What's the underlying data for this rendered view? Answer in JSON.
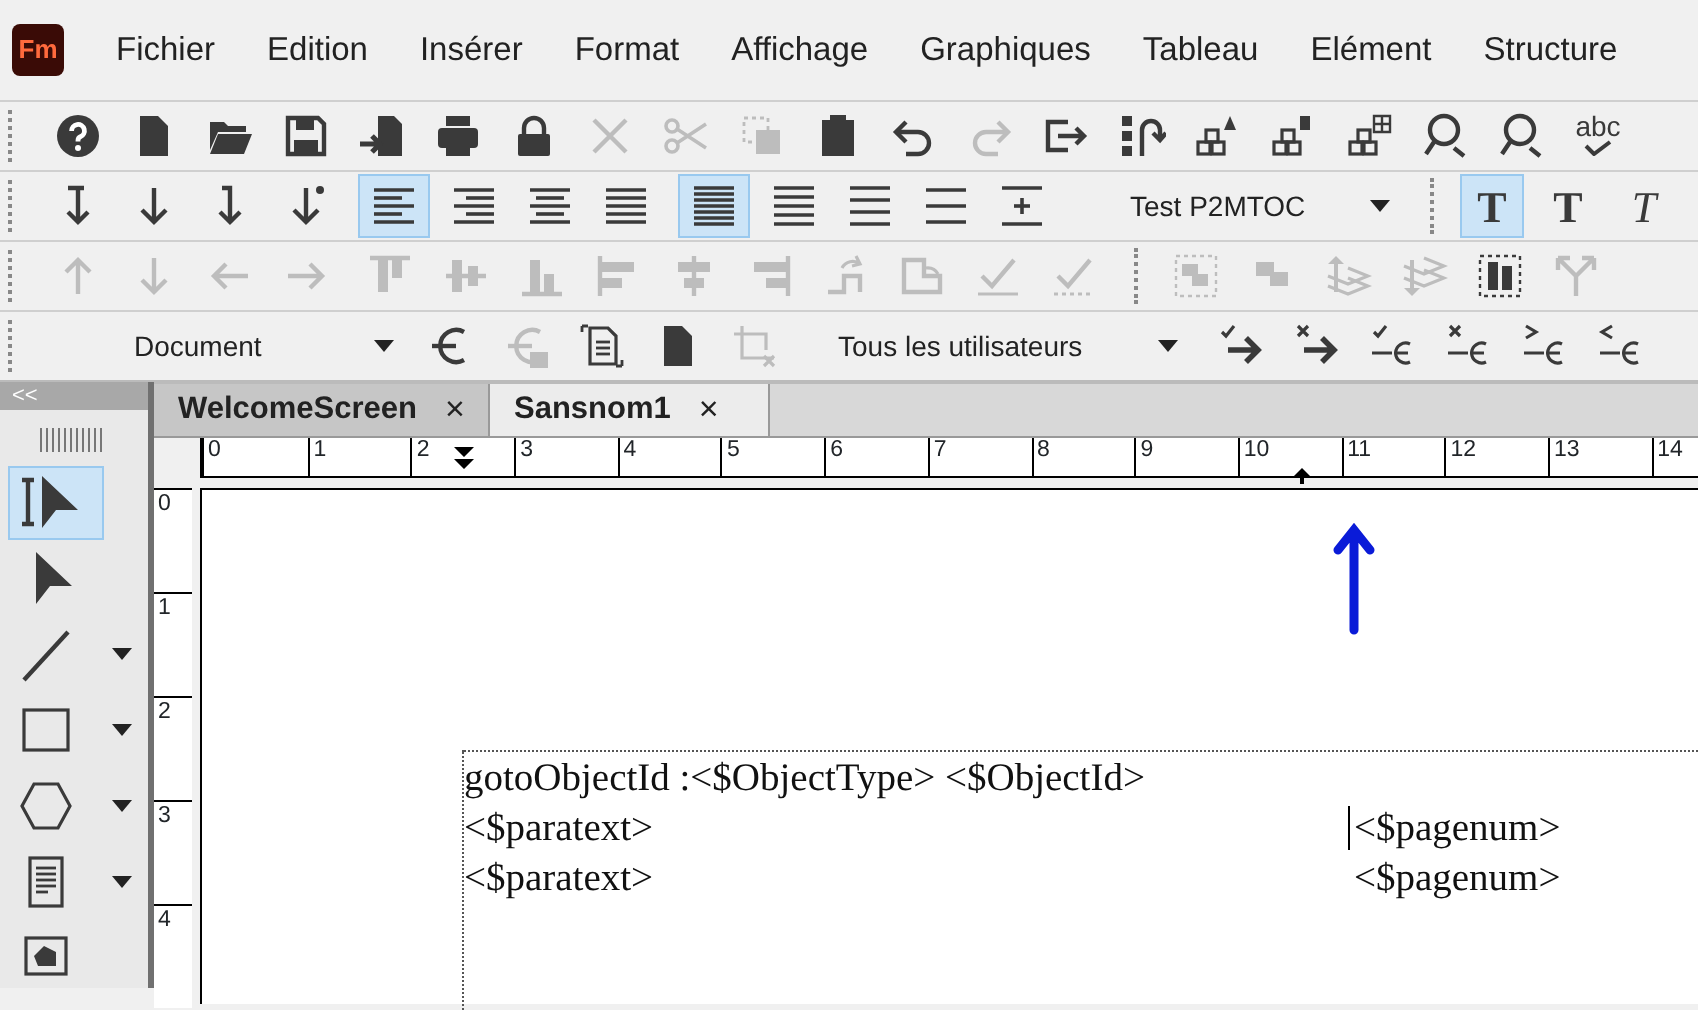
{
  "app": {
    "logo": "Fm"
  },
  "menu": [
    {
      "label": "Fichier"
    },
    {
      "label": "Edition"
    },
    {
      "label": "Insérer"
    },
    {
      "label": "Format"
    },
    {
      "label": "Affichage"
    },
    {
      "label": "Graphiques"
    },
    {
      "label": "Tableau"
    },
    {
      "label": "Elément"
    },
    {
      "label": "Structure"
    }
  ],
  "toolbars": [
    {
      "items": [
        {
          "kind": "help",
          "disabled": false
        },
        {
          "kind": "document",
          "disabled": false
        },
        {
          "kind": "folder",
          "disabled": false
        },
        {
          "kind": "save",
          "disabled": false
        },
        {
          "kind": "import",
          "disabled": false
        },
        {
          "kind": "print",
          "disabled": false
        },
        {
          "kind": "lock",
          "disabled": false
        },
        {
          "kind": "cross",
          "disabled": true
        },
        {
          "kind": "scissors",
          "disabled": true
        },
        {
          "kind": "copy",
          "disabled": true
        },
        {
          "kind": "clipboard",
          "disabled": false
        },
        {
          "kind": "undo",
          "disabled": false
        },
        {
          "kind": "redo",
          "disabled": true
        },
        {
          "kind": "forward",
          "disabled": false
        },
        {
          "kind": "list-arrow",
          "disabled": false
        },
        {
          "kind": "boxes-triangle",
          "disabled": false
        },
        {
          "kind": "boxes-square",
          "disabled": false
        },
        {
          "kind": "boxes-grid",
          "disabled": false
        },
        {
          "kind": "magnifier",
          "disabled": false
        },
        {
          "kind": "magnifier",
          "disabled": false
        },
        {
          "kind": "spellcheck",
          "label": "abc",
          "disabled": false
        }
      ]
    },
    {
      "items": [
        {
          "kind": "arrow-down-bar",
          "selected": false,
          "disabled": false
        },
        {
          "kind": "arrow-down",
          "selected": false,
          "disabled": false
        },
        {
          "kind": "arrow-down-hook",
          "selected": false,
          "disabled": false
        },
        {
          "kind": "arrow-down-dot",
          "selected": false,
          "disabled": false
        },
        {
          "kind": "align-left",
          "selected": true,
          "disabled": false
        },
        {
          "kind": "align-right",
          "selected": false,
          "disabled": false
        },
        {
          "kind": "align-center",
          "selected": false,
          "disabled": false
        },
        {
          "kind": "align-justify",
          "selected": false,
          "disabled": false
        },
        {
          "kind": "lines-dense",
          "selected": true,
          "disabled": false
        },
        {
          "kind": "lines-medium",
          "selected": false,
          "disabled": false
        },
        {
          "kind": "lines-loose",
          "selected": false,
          "disabled": false
        },
        {
          "kind": "lines-wide",
          "selected": false,
          "disabled": false
        },
        {
          "kind": "lines-plus",
          "selected": false,
          "disabled": false
        },
        {
          "kind": "dropdown",
          "value": "Test P2MTOC"
        },
        {
          "kind": "separator"
        },
        {
          "kind": "letter-regular",
          "label": "T",
          "selected": true,
          "disabled": false
        },
        {
          "kind": "letter-bold",
          "label": "T",
          "selected": false,
          "disabled": false
        },
        {
          "kind": "letter-italic",
          "label": "T",
          "selected": false,
          "disabled": false
        }
      ]
    },
    {
      "items": [
        {
          "kind": "arrow-up",
          "disabled": true
        },
        {
          "kind": "arrow-down",
          "disabled": true
        },
        {
          "kind": "arrow-left",
          "disabled": true
        },
        {
          "kind": "arrow-right",
          "disabled": true
        },
        {
          "kind": "align-top",
          "disabled": true
        },
        {
          "kind": "align-middle",
          "disabled": true
        },
        {
          "kind": "align-bottom",
          "disabled": true
        },
        {
          "kind": "align-left-edge",
          "disabled": true
        },
        {
          "kind": "align-center-edge",
          "disabled": true
        },
        {
          "kind": "align-right-edge",
          "disabled": true
        },
        {
          "kind": "rotate-right",
          "disabled": true
        },
        {
          "kind": "rotate-left",
          "disabled": true
        },
        {
          "kind": "check",
          "disabled": true
        },
        {
          "kind": "check-dashed",
          "disabled": true
        },
        {
          "kind": "separator"
        },
        {
          "kind": "group",
          "disabled": true
        },
        {
          "kind": "ungroup",
          "disabled": true
        },
        {
          "kind": "layers-up",
          "disabled": true
        },
        {
          "kind": "layers-down",
          "disabled": true
        },
        {
          "kind": "distribute",
          "disabled": false
        },
        {
          "kind": "fork",
          "disabled": true
        }
      ]
    },
    {
      "items": [
        {
          "kind": "dropdown",
          "value": "Document"
        },
        {
          "kind": "euro",
          "disabled": false
        },
        {
          "kind": "euro-lock",
          "disabled": true
        },
        {
          "kind": "document-lines",
          "disabled": false
        },
        {
          "kind": "document",
          "disabled": false
        },
        {
          "kind": "crop-cross",
          "disabled": true
        },
        {
          "kind": "dropdown",
          "value": "Tous les utilisateurs"
        },
        {
          "kind": "check-arrow",
          "disabled": false
        },
        {
          "kind": "cross-arrow",
          "disabled": false
        },
        {
          "kind": "check-euro",
          "disabled": false
        },
        {
          "kind": "cross-euro",
          "disabled": false
        },
        {
          "kind": "greater-euro",
          "disabled": false
        },
        {
          "kind": "less-euro",
          "disabled": false
        }
      ]
    }
  ],
  "toolbox": {
    "collapse": "<<",
    "tools": [
      {
        "kind": "text-pointer",
        "selected": true,
        "menu": false
      },
      {
        "kind": "pointer",
        "selected": false,
        "menu": false
      },
      {
        "kind": "line",
        "selected": false,
        "menu": true
      },
      {
        "kind": "rectangle",
        "selected": false,
        "menu": true
      },
      {
        "kind": "hexagon",
        "selected": false,
        "menu": true
      },
      {
        "kind": "text-frame",
        "selected": false,
        "menu": true
      },
      {
        "kind": "graphic-frame",
        "selected": false,
        "menu": false
      }
    ]
  },
  "tabs": [
    {
      "label": "WelcomeScreen",
      "close": "×",
      "selected": false
    },
    {
      "label": "Sansnom1",
      "close": "×",
      "selected": true
    }
  ],
  "ruler": {
    "horizontal": [
      "0",
      "1",
      "2",
      "3",
      "4",
      "5",
      "6",
      "7",
      "8",
      "9",
      "10",
      "11",
      "12",
      "13",
      "14"
    ],
    "vertical": [
      "0",
      "1",
      "2",
      "3",
      "4"
    ]
  },
  "document": {
    "lines": [
      {
        "text": "gotoObjectId :<$ObjectType> <$ObjectId>"
      },
      {
        "text": "<$paratext>",
        "page": "<$pagenum>",
        "cursor": true
      },
      {
        "text": "<$paratext>",
        "page": "<$pagenum>",
        "cursor": false
      }
    ]
  }
}
